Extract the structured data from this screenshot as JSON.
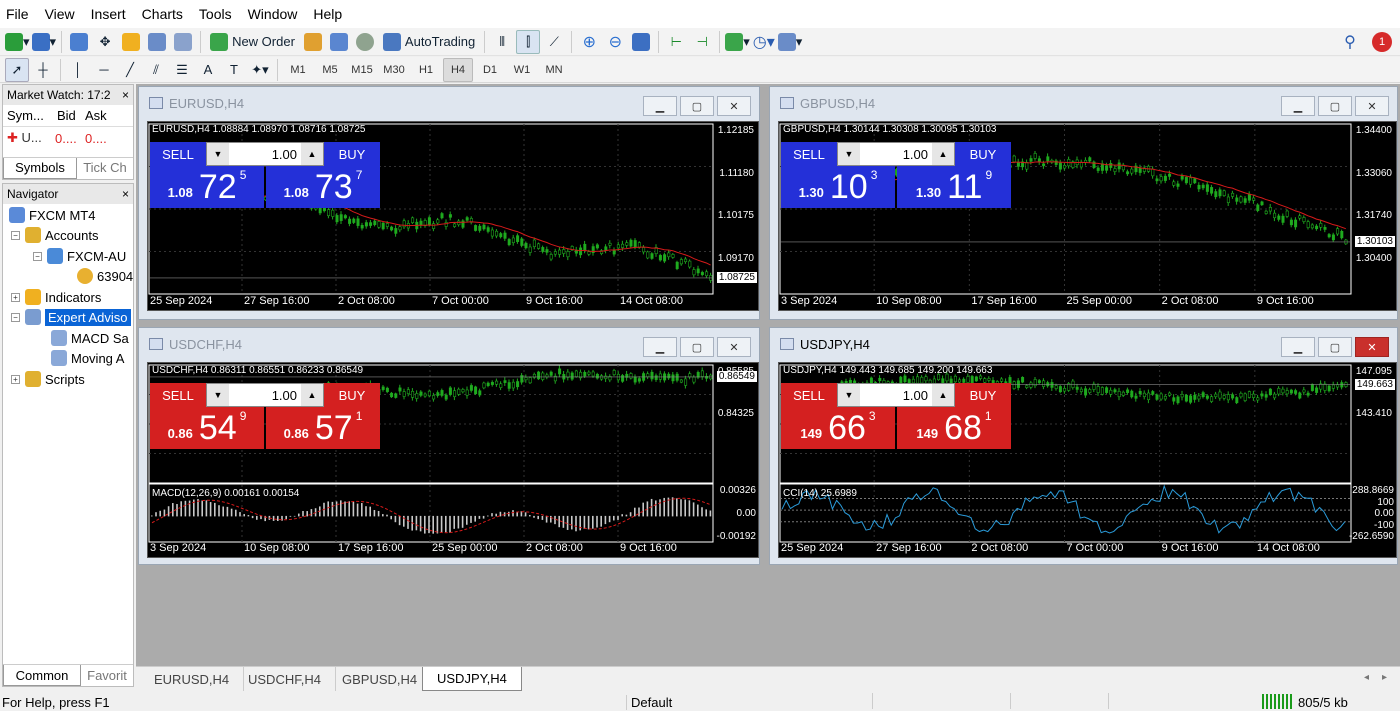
{
  "menu": [
    "File",
    "View",
    "Insert",
    "Charts",
    "Tools",
    "Window",
    "Help"
  ],
  "toolbar": {
    "new_order": "New Order",
    "autotrading": "AutoTrading",
    "notification_count": "1"
  },
  "timeframes": [
    "M1",
    "M5",
    "M15",
    "M30",
    "H1",
    "H4",
    "D1",
    "W1",
    "MN"
  ],
  "active_timeframe": "H4",
  "market_watch": {
    "title": "Market Watch: 17:2",
    "cols": [
      "Sym...",
      "Bid",
      "Ask"
    ],
    "row": {
      "symbol": "U...",
      "bid": "0....",
      "ask": "0...."
    },
    "tabs": [
      "Symbols",
      "Tick Ch"
    ]
  },
  "navigator": {
    "title": "Navigator",
    "root": "FXCM MT4",
    "accounts": "Accounts",
    "account_server": "FXCM-AU",
    "account_id": "63904",
    "indicators": "Indicators",
    "expert_advisors": "Expert Adviso",
    "ea1": "MACD Sa",
    "ea2": "Moving A",
    "scripts": "Scripts",
    "tabs": [
      "Common",
      "Favorit"
    ]
  },
  "charts": [
    {
      "title": "EURUSD,H4",
      "ohlc": "EURUSD,H4  1.08884 1.08970 1.08716 1.08725",
      "theme": "blue",
      "sell_label": "SELL",
      "buy_label": "BUY",
      "lot": "1.00",
      "bid_small": "1.08",
      "bid_big": "72",
      "bid_sup": "5",
      "ask_small": "1.08",
      "ask_big": "73",
      "ask_sup": "7",
      "yticks": [
        "1.12185",
        "1.11180",
        "1.10175",
        "1.09170"
      ],
      "last": "1.08725",
      "xticks": [
        "25 Sep 2024",
        "27 Sep 16:00",
        "2 Oct 08:00",
        "7 Oct 00:00",
        "9 Oct 16:00",
        "14 Oct 08:00"
      ]
    },
    {
      "title": "GBPUSD,H4",
      "ohlc": "GBPUSD,H4  1.30144 1.30308 1.30095 1.30103",
      "theme": "blue",
      "sell_label": "SELL",
      "buy_label": "BUY",
      "lot": "1.00",
      "bid_small": "1.30",
      "bid_big": "10",
      "bid_sup": "3",
      "ask_small": "1.30",
      "ask_big": "11",
      "ask_sup": "9",
      "yticks": [
        "1.34400",
        "1.33060",
        "1.31740",
        "1.30400"
      ],
      "last": "1.30103",
      "xticks": [
        "3 Sep 2024",
        "10 Sep 08:00",
        "17 Sep 16:00",
        "25 Sep 00:00",
        "2 Oct 08:00",
        "9 Oct 16:00"
      ]
    },
    {
      "title": "USDCHF,H4",
      "ohlc": "USDCHF,H4  0.86311 0.86551 0.86233 0.86549",
      "theme": "red",
      "sell_label": "SELL",
      "buy_label": "BUY",
      "lot": "1.00",
      "bid_small": "0.86",
      "bid_big": "54",
      "bid_sup": "9",
      "ask_small": "0.86",
      "ask_big": "57",
      "ask_sup": "1",
      "yticks": [
        "0.85585",
        "0.84325"
      ],
      "last": "0.86549",
      "ind_label": "MACD(12,26,9) 0.00161 0.00154",
      "ind_ticks": [
        "0.00326",
        "0.00",
        "-0.00192"
      ],
      "xticks": [
        "3 Sep 2024",
        "10 Sep 08:00",
        "17 Sep 16:00",
        "25 Sep 00:00",
        "2 Oct 08:00",
        "9 Oct 16:00"
      ]
    },
    {
      "title": "USDJPY,H4",
      "ohlc": "USDJPY,H4  149.443 149.685 149.200 149.663",
      "theme": "red",
      "sell_label": "SELL",
      "buy_label": "BUY",
      "lot": "1.00",
      "bid_small": "149",
      "bid_big": "66",
      "bid_sup": "3",
      "ask_small": "149",
      "ask_big": "68",
      "ask_sup": "1",
      "yticks": [
        "147.095",
        "143.410"
      ],
      "last": "149.663",
      "ind_label": "CCI(14) 25.6989",
      "ind_ticks": [
        "288.8669",
        "100",
        "0.00",
        "-100",
        "-262.6590"
      ],
      "xticks": [
        "25 Sep 2024",
        "27 Sep 16:00",
        "2 Oct 08:00",
        "7 Oct 00:00",
        "9 Oct 16:00",
        "14 Oct 08:00"
      ]
    }
  ],
  "tabs": [
    "EURUSD,H4",
    "USDCHF,H4",
    "GBPUSD,H4",
    "USDJPY,H4"
  ],
  "active_tab": "USDJPY,H4",
  "status": {
    "help": "For Help, press F1",
    "profile": "Default",
    "traffic": "805/5 kb"
  },
  "colors": {
    "up": "#1faa1f",
    "ma": "#d61a1a",
    "blue_panel": "#2430d8",
    "red_panel": "#d42020"
  }
}
